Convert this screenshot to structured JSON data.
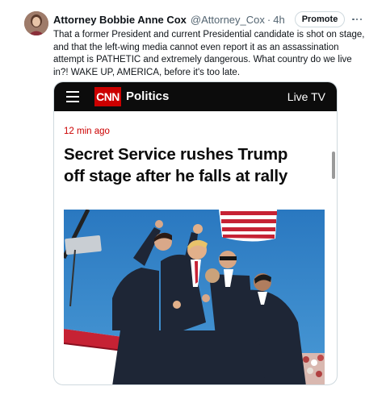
{
  "tweet": {
    "author_name": "Attorney Bobbie Anne Cox",
    "author_handle": "@Attorney_Cox",
    "separator": "·",
    "time": "4h",
    "promote_label": "Promote",
    "text_lines": [
      "That a former President and current Presidential candidate is shot on stage,",
      "and that the left-wing media cannot even report it as an assassination",
      "attempt is PATHETIC and extremely dangerous. What country do we live",
      "in?!  WAKE UP, AMERICA, before it's too late."
    ]
  },
  "cnn": {
    "logo_text": "CNN",
    "section": "Politics",
    "live_tv": "Live TV",
    "article_time": "12 min ago",
    "headline_lines": [
      "Secret Service rushes Trump",
      "off stage after he falls at rally"
    ]
  },
  "icons": {
    "avatar": "author-avatar",
    "more": "more-options-icon",
    "menu": "hamburger-menu-icon"
  },
  "colors": {
    "cnn_red": "#cc0000",
    "cnn_bar": "#0c0c0c",
    "text_primary": "#0f1419",
    "text_secondary": "#536471",
    "sky": "#2f7fc4"
  }
}
